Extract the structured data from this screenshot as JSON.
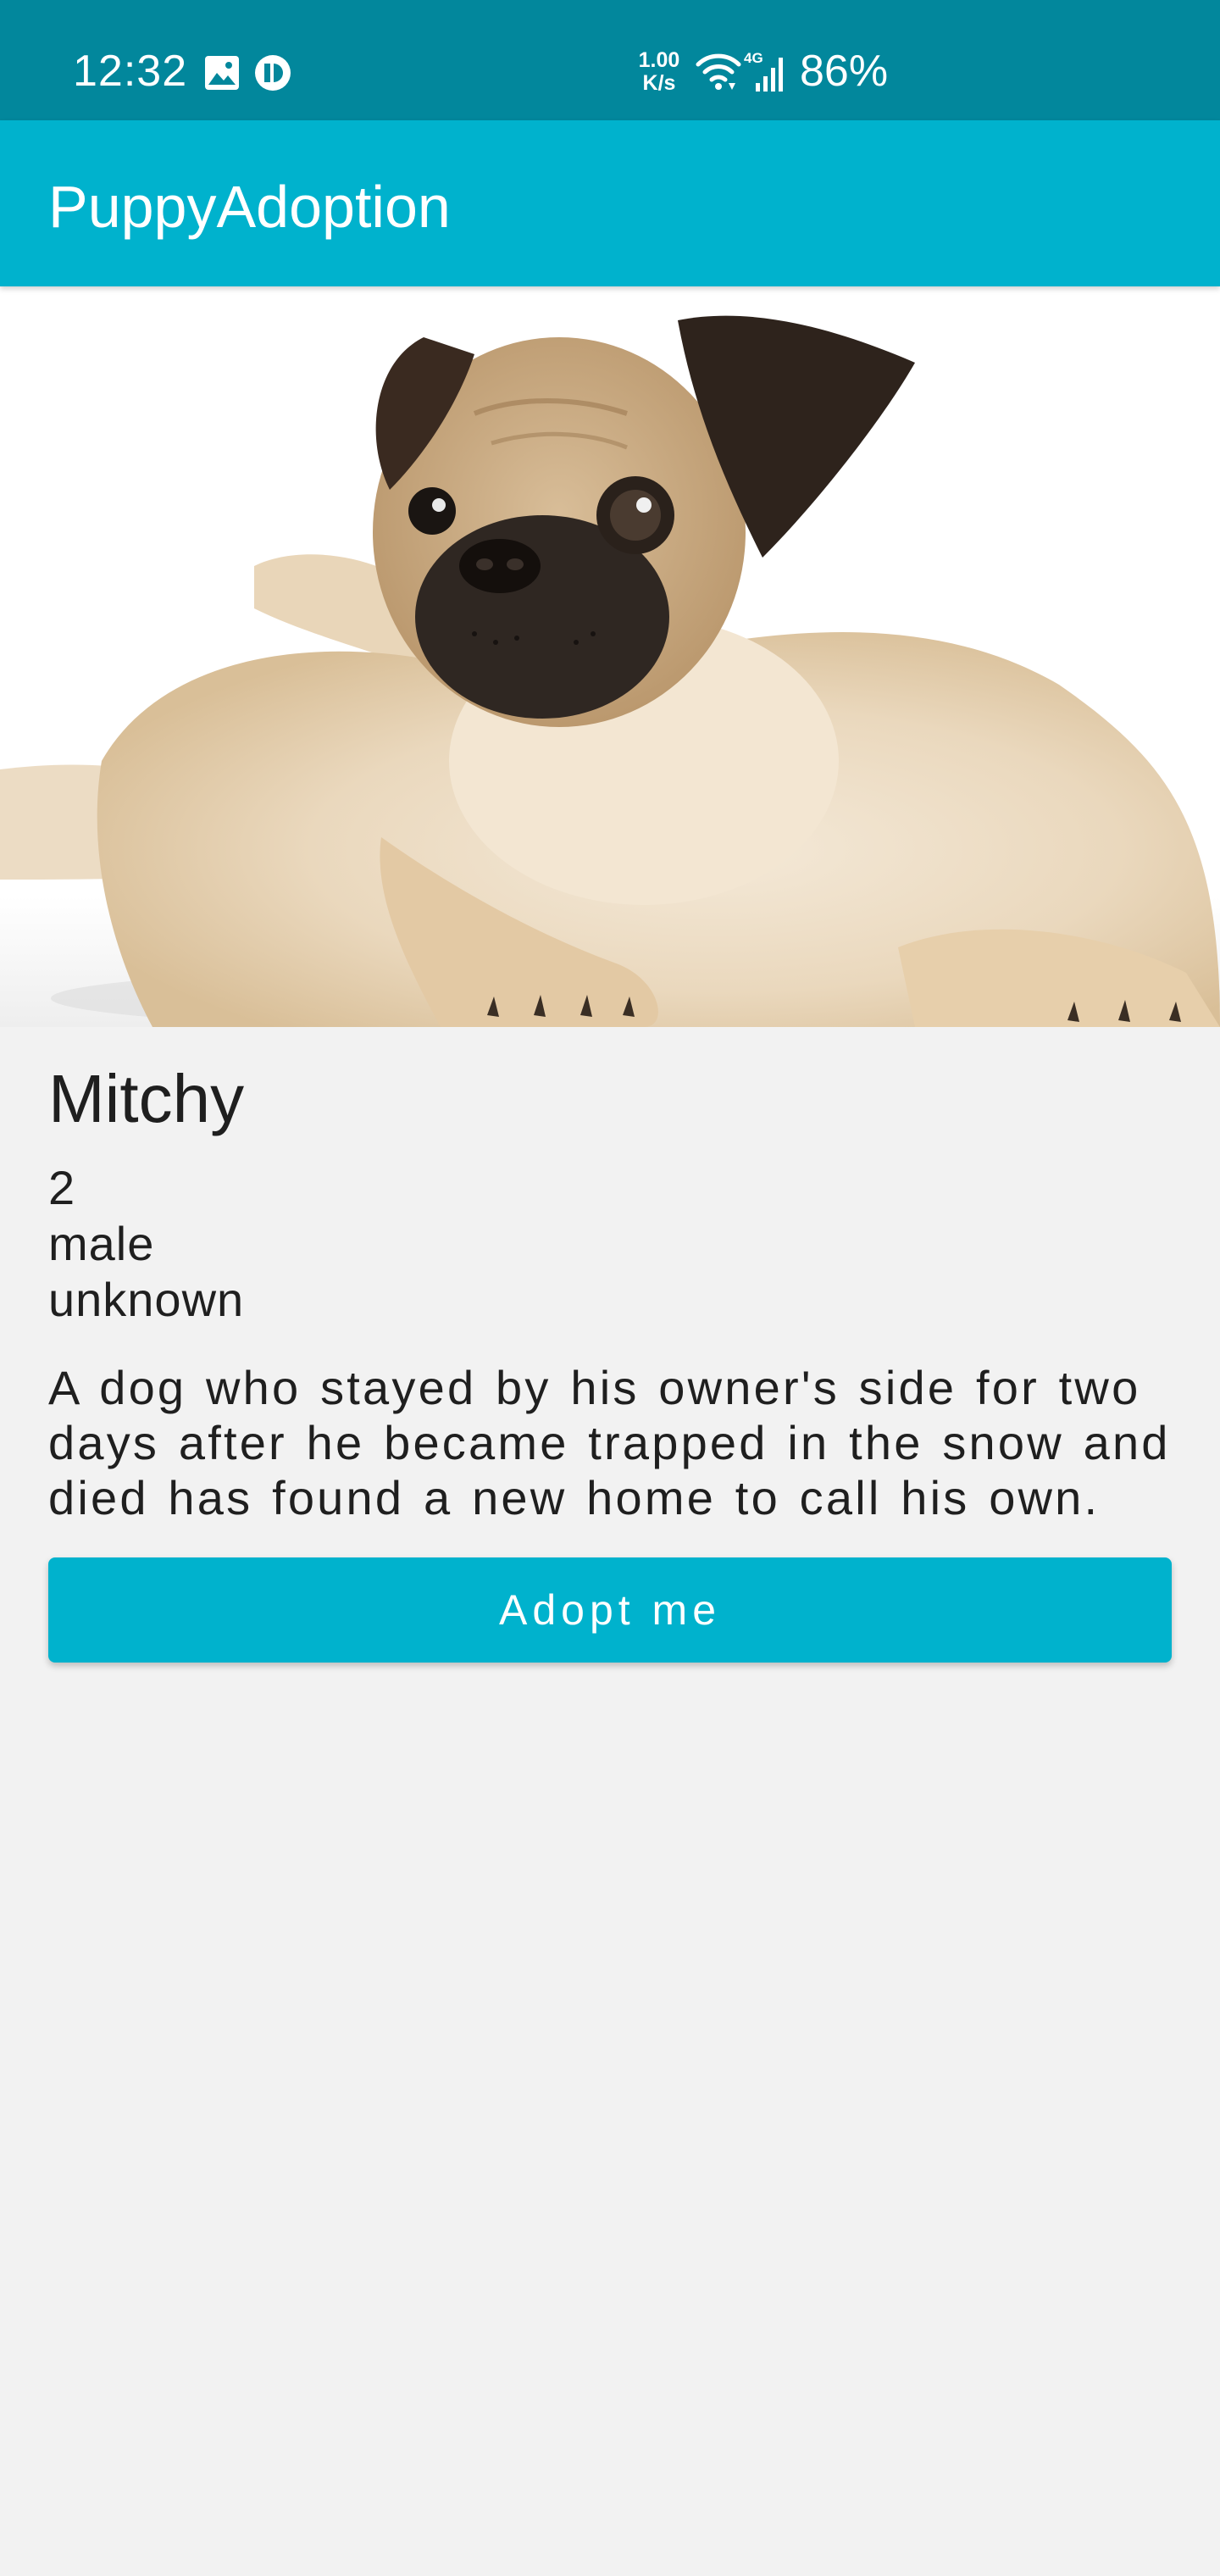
{
  "status_bar": {
    "time": "12:32",
    "net_speed_value": "1.00",
    "net_speed_unit": "K/s",
    "network_type": "4G",
    "battery": "86%",
    "icons": [
      "image-icon",
      "app-notification-icon",
      "wifi-icon",
      "signal-icon"
    ]
  },
  "app_bar": {
    "title": "PuppyAdoption"
  },
  "puppy": {
    "image": "pug-puppy-photo",
    "name": "Mitchy",
    "age": "2",
    "gender": "male",
    "breed": "unknown",
    "description": "A dog who stayed by his owner's side for two days after he became trapped in the snow and died has found a new home to call his own."
  },
  "actions": {
    "adopt_label": "Adopt me"
  },
  "colors": {
    "status_bar": "#02879c",
    "primary": "#00b2cd",
    "background": "#f2f2f2",
    "text": "#1f1f1f"
  }
}
